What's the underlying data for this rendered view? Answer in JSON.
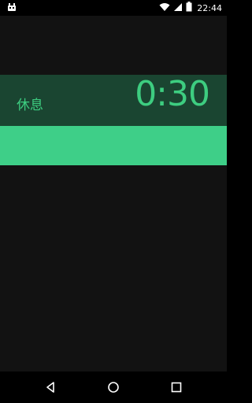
{
  "status_bar": {
    "time": "22:44",
    "icons": [
      "android-debug-icon",
      "wifi-icon",
      "cell-signal-icon",
      "battery-icon"
    ]
  },
  "timer": {
    "label": "休息",
    "value": "0:30",
    "progress": 1.0
  },
  "colors": {
    "background": "#121212",
    "band": "#1a4531",
    "accent": "#3dcd80",
    "progress": "#3ecf88"
  },
  "nav_bar": {
    "icons": [
      "back-icon",
      "home-icon",
      "recents-icon"
    ]
  }
}
